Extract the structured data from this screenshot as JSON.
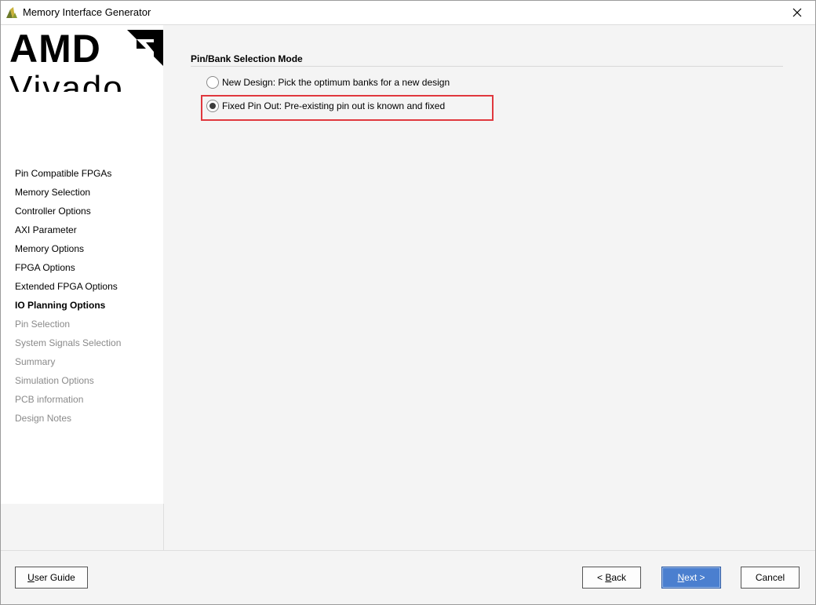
{
  "window": {
    "title": "Memory Interface Generator"
  },
  "logo": {
    "brand": "AMD",
    "product": "Vivado"
  },
  "sidebar": {
    "items": [
      {
        "label": "Pin Compatible FPGAs",
        "state": "done"
      },
      {
        "label": "Memory Selection",
        "state": "done"
      },
      {
        "label": "Controller Options",
        "state": "done"
      },
      {
        "label": "AXI Parameter",
        "state": "done"
      },
      {
        "label": "Memory Options",
        "state": "done"
      },
      {
        "label": "FPGA Options",
        "state": "done"
      },
      {
        "label": "Extended FPGA Options",
        "state": "done"
      },
      {
        "label": "IO Planning Options",
        "state": "current"
      },
      {
        "label": "Pin Selection",
        "state": "pending"
      },
      {
        "label": "System Signals Selection",
        "state": "pending"
      },
      {
        "label": "Summary",
        "state": "pending"
      },
      {
        "label": "Simulation Options",
        "state": "pending"
      },
      {
        "label": "PCB information",
        "state": "pending"
      },
      {
        "label": "Design Notes",
        "state": "pending"
      }
    ]
  },
  "main": {
    "section_title": "Pin/Bank Selection Mode",
    "options": [
      {
        "label": "New Design: Pick the optimum banks for a new design",
        "selected": false
      },
      {
        "label": "Fixed Pin Out: Pre-existing pin out is known and fixed",
        "selected": true
      }
    ],
    "highlight_color": "#e0383e"
  },
  "buttons": {
    "user_guide": {
      "mnemonic": "U",
      "rest": "ser Guide"
    },
    "back": {
      "prefix": "< ",
      "mnemonic": "B",
      "rest": "ack"
    },
    "next": {
      "mnemonic": "N",
      "rest": "ext >"
    },
    "cancel": "Cancel"
  },
  "colors": {
    "primary_button": "#4b7fcf",
    "pending_text": "#8a8a8a"
  }
}
